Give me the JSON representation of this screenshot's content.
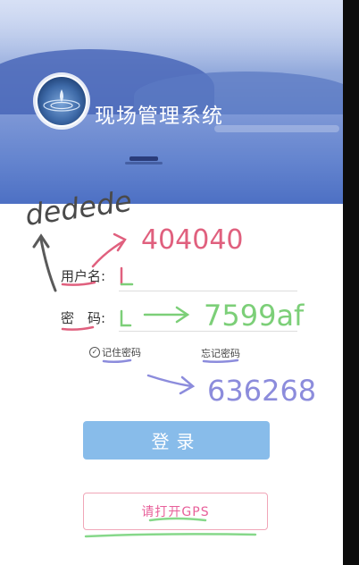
{
  "header": {
    "app_title": "现场管理系统",
    "logo_icon": "water-drop-icon"
  },
  "form": {
    "username_label": "用户名:",
    "username_value": "",
    "password_label": "密　码:",
    "password_value": "",
    "remember_label": "记住密码",
    "forgot_label": "忘记密码"
  },
  "buttons": {
    "login": "登录",
    "gps": "请打开GPS"
  },
  "annotations": {
    "top_word": "dedede",
    "username_note": "404040",
    "password_note": "7599af",
    "remember_note": "636268"
  },
  "colors": {
    "login_button": "#88bcea",
    "gps_text": "#e8609a"
  }
}
